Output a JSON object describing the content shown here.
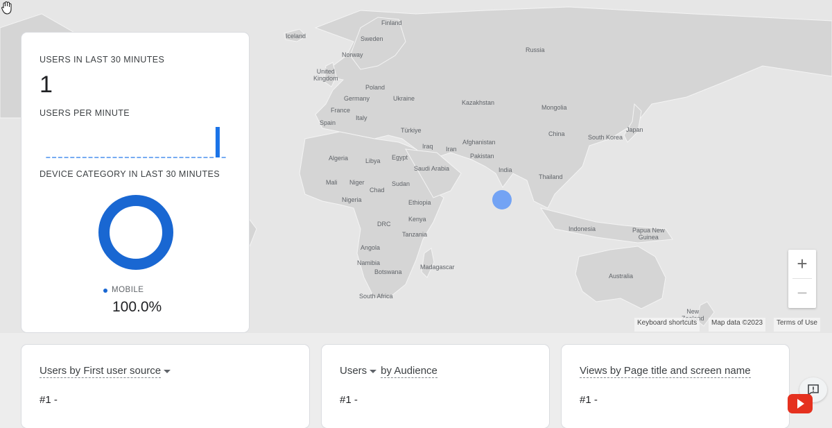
{
  "map": {
    "labels": {
      "iceland": "Iceland",
      "finland": "Finland",
      "sweden": "Sweden",
      "norway": "Norway",
      "russia": "Russia",
      "uk": "United\nKingdom",
      "poland": "Poland",
      "germany": "Germany",
      "ukraine": "Ukraine",
      "kazakhstan": "Kazakhstan",
      "mongolia": "Mongolia",
      "france": "France",
      "italy": "Italy",
      "spain": "Spain",
      "turkiye": "Türkiye",
      "china": "China",
      "japan": "Japan",
      "south_korea": "South Korea",
      "iraq": "Iraq",
      "iran": "Iran",
      "afghanistan": "Afghanistan",
      "pakistan": "Pakistan",
      "algeria": "Algeria",
      "libya": "Libya",
      "egypt": "Egypt",
      "saudi_arabia": "Saudi Arabia",
      "india": "India",
      "mali": "Mali",
      "niger": "Niger",
      "sudan": "Sudan",
      "chad": "Chad",
      "thailand": "Thailand",
      "nigeria": "Nigeria",
      "ethiopia": "Ethiopia",
      "kenya": "Kenya",
      "drc": "DRC",
      "indonesia": "Indonesia",
      "papua_new_guinea": "Papua New\nGuinea",
      "tanzania": "Tanzania",
      "angola": "Angola",
      "madagascar": "Madagascar",
      "namibia": "Namibia",
      "botswana": "Botswana",
      "australia": "Australia",
      "south_africa": "South Africa",
      "new_zealand": "New\nZealand"
    },
    "zoom_in": "+",
    "zoom_out": "−",
    "attribution": {
      "shortcuts": "Keyboard shortcuts",
      "map_data": "Map data ©2023",
      "terms": "Terms of Use"
    }
  },
  "realtime": {
    "users_label": "USERS IN LAST 30 MINUTES",
    "users_value": "1",
    "per_minute_label": "USERS PER MINUTE",
    "per_minute_series": [
      0,
      0,
      0,
      0,
      0,
      0,
      0,
      0,
      0,
      0,
      0,
      0,
      0,
      0,
      0,
      0,
      0,
      0,
      0,
      0,
      0,
      0,
      0,
      0,
      0,
      0,
      0,
      0,
      1,
      0
    ],
    "device_label": "DEVICE CATEGORY IN LAST 30 MINUTES",
    "device_legend_name": "MOBILE",
    "device_legend_value": "100.0%",
    "device_share": 1.0
  },
  "cards": [
    {
      "title_a": "Users by First user source",
      "title_b": "",
      "rank": "#1 -"
    },
    {
      "title_a": "Users",
      "title_b": "by Audience",
      "rank": "#1 -"
    },
    {
      "title_a": "Views by Page title and screen name",
      "title_b": "",
      "rank": "#1 -"
    }
  ],
  "colors": {
    "accent": "#1a73e8",
    "map_land": "#d6d6d6",
    "map_sea": "#e8e8e8",
    "active_dot": "#5e97f6"
  }
}
